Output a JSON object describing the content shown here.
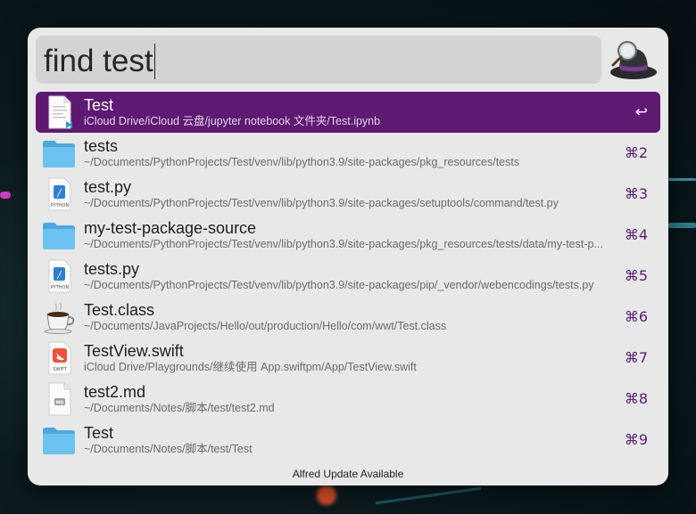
{
  "search": {
    "query": "find test"
  },
  "results": [
    {
      "title": "Test",
      "subtitle": "iCloud Drive/iCloud 云盘/jupyter notebook 文件夹/Test.ipynb",
      "shortcut": "↩",
      "icon": "notebook-doc-icon",
      "selected": true
    },
    {
      "title": "tests",
      "subtitle": "~/Documents/PythonProjects/Test/venv/lib/python3.9/site-packages/pkg_resources/tests",
      "shortcut": "⌘2",
      "icon": "folder-icon"
    },
    {
      "title": "test.py",
      "subtitle": "~/Documents/PythonProjects/Test/venv/lib/python3.9/site-packages/setuptools/command/test.py",
      "shortcut": "⌘3",
      "icon": "python-file-icon"
    },
    {
      "title": "my-test-package-source",
      "subtitle": "~/Documents/PythonProjects/Test/venv/lib/python3.9/site-packages/pkg_resources/tests/data/my-test-p...",
      "shortcut": "⌘4",
      "icon": "folder-icon"
    },
    {
      "title": "tests.py",
      "subtitle": "~/Documents/PythonProjects/Test/venv/lib/python3.9/site-packages/pip/_vendor/webencodings/tests.py",
      "shortcut": "⌘5",
      "icon": "python-file-icon"
    },
    {
      "title": "Test.class",
      "subtitle": "~/Documents/JavaProjects/Hello/out/production/Hello/com/wwt/Test.class",
      "shortcut": "⌘6",
      "icon": "java-coffee-icon"
    },
    {
      "title": "TestView.swift",
      "subtitle": "iCloud Drive/Playgrounds/继续使用 App.swiftpm/App/TestView.swift",
      "shortcut": "⌘7",
      "icon": "swift-file-icon"
    },
    {
      "title": "test2.md",
      "subtitle": "~/Documents/Notes/脚本/test/test2.md",
      "shortcut": "⌘8",
      "icon": "markdown-file-icon"
    },
    {
      "title": "Test",
      "subtitle": "~/Documents/Notes/脚本/test/Test",
      "shortcut": "⌘9",
      "icon": "folder-icon"
    }
  ],
  "icon_labels": {
    "python": "PYTHON",
    "swift": "SWIFT",
    "markdown": "MD"
  },
  "footer": {
    "text": "Alfred Update Available"
  },
  "colors": {
    "selection": "#5e1a73",
    "shortcut": "#5a1c6e",
    "folder": "#5ab8ec",
    "panel": "#e8e8e8"
  }
}
